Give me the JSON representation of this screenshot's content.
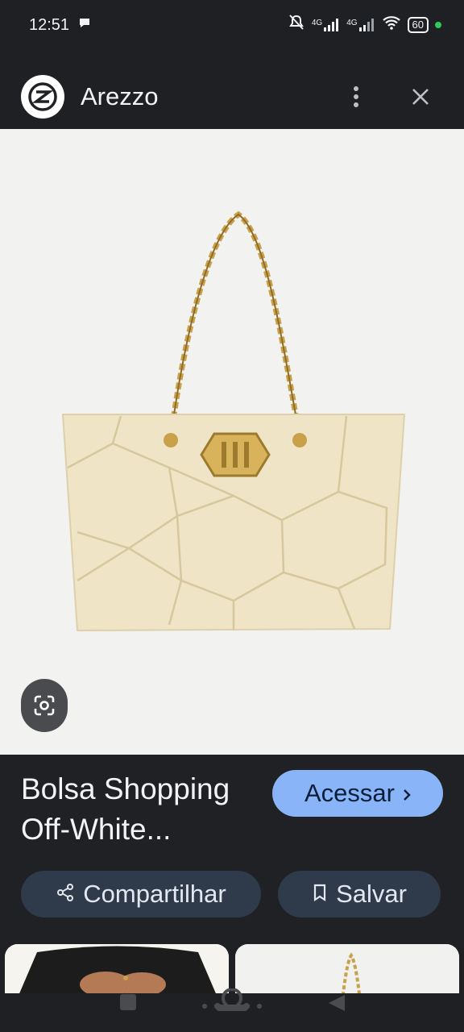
{
  "status": {
    "time": "12:51",
    "battery": "60",
    "network_1": "4G",
    "network_2": "4G"
  },
  "header": {
    "site_name": "Arezzo",
    "logo_icon": "arezzo-logo-icon",
    "more_icon": "more-vert-icon",
    "close_icon": "close-icon"
  },
  "product": {
    "title": "Bolsa Shopping Off-White...",
    "access_label": "Acessar",
    "access_icon": "chevron-right-icon"
  },
  "actions": {
    "share_label": "Compartilhar",
    "share_icon": "share-icon",
    "save_label": "Salvar",
    "save_icon": "bookmark-icon"
  },
  "lens": {
    "icon": "google-lens-icon"
  },
  "colors": {
    "background": "#202124",
    "accent": "#8ab4f8",
    "chip": "#2f3a4a",
    "image_bg": "#f2f2f1",
    "bag": "#efe5c6",
    "gold": "#c9a14a"
  }
}
